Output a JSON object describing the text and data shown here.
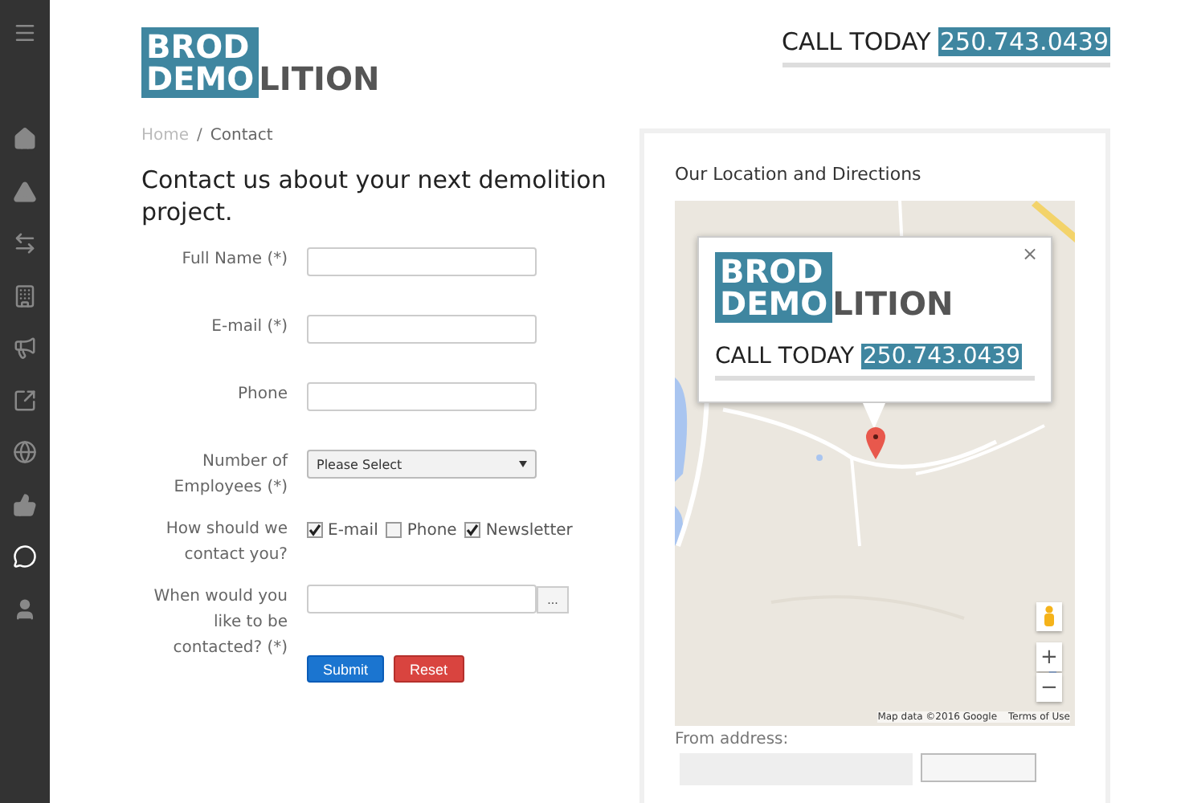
{
  "sidebar": {
    "items": [
      {
        "selected": false
      },
      {
        "selected": false
      },
      {
        "selected": false
      },
      {
        "selected": false
      },
      {
        "selected": false
      },
      {
        "selected": false
      },
      {
        "selected": false
      },
      {
        "selected": false
      },
      {
        "selected": false
      },
      {
        "selected": true
      },
      {
        "selected": false
      }
    ]
  },
  "header": {
    "logo": {
      "boxed_lines": [
        "BROD",
        "DEMO"
      ],
      "rest": "LITION"
    },
    "call": {
      "label": "CALL TODAY",
      "phone": "250.743.0439"
    }
  },
  "breadcrumb": {
    "separator": "/",
    "items": [
      "Home",
      "Contact"
    ]
  },
  "form": {
    "title": "Contact us about your next demolition project.",
    "fields": [
      {
        "kind": "text",
        "label": "Full Name (*)"
      },
      {
        "kind": "text",
        "label": "E-mail (*)"
      },
      {
        "kind": "text",
        "label": "Phone"
      },
      {
        "kind": "select",
        "label": "Number of Employees (*)",
        "value": "Please Select"
      },
      {
        "kind": "checks",
        "label": "How should we contact you?",
        "options": [
          {
            "label": "E-mail",
            "checked": true
          },
          {
            "label": "Phone",
            "checked": false
          },
          {
            "label": "Newsletter",
            "checked": true
          }
        ]
      },
      {
        "kind": "date",
        "label": "When would you like to be contacted? (*)",
        "button": "..."
      }
    ],
    "buttons": [
      "Submit",
      "Reset"
    ]
  },
  "location": {
    "title": "Our Location and Directions",
    "map": {
      "popup": {
        "logo": {
          "boxed_lines": [
            "BROD",
            "DEMO"
          ],
          "rest": "LITION"
        },
        "call": {
          "label": "CALL TODAY",
          "phone": "250.743.0439"
        },
        "close": "×"
      },
      "zoom": [
        "+",
        "−"
      ],
      "attribution": "Map data ©2016 Google",
      "terms": "Terms of Use"
    },
    "from_label": "From address:"
  }
}
